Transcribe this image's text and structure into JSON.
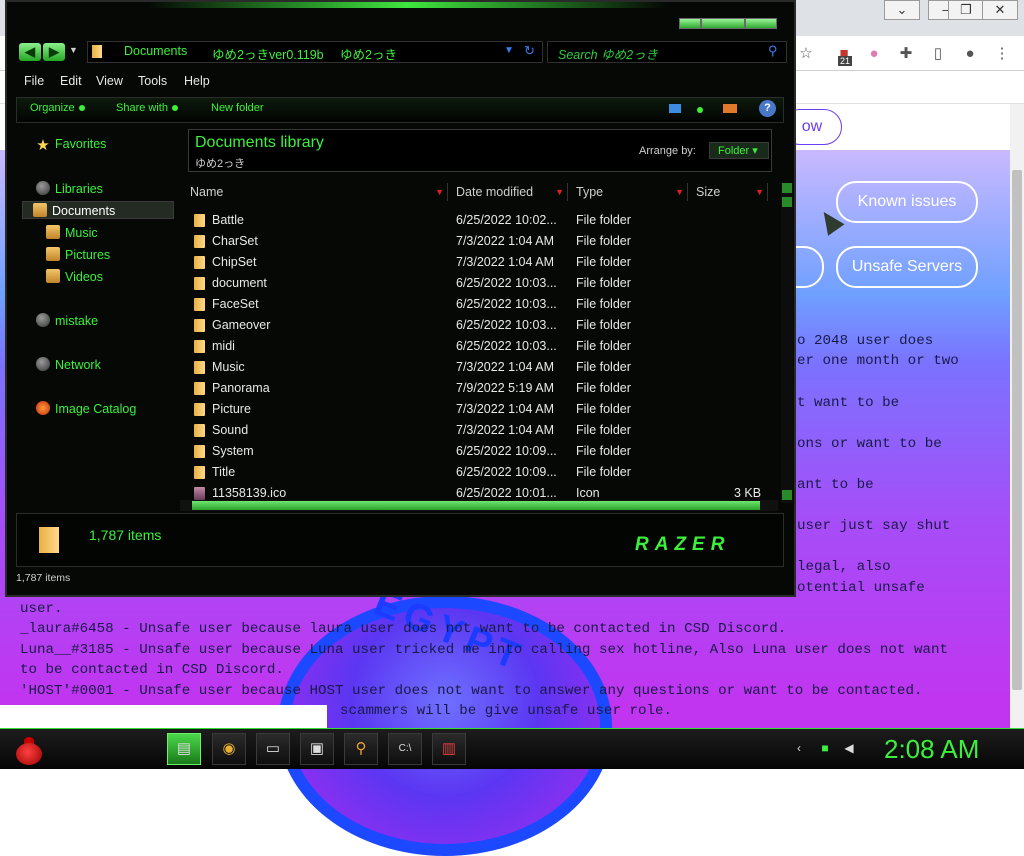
{
  "browser": {
    "pill_now": "ow",
    "known_issues": "Known issues",
    "unsafe_servers": "Unsafe Servers",
    "pill_cut": "s",
    "page_lines": [
      "o 2048 user does",
      "er one month or two",
      "t want to be",
      "ons or want to be",
      "ant to be",
      "user just say shut",
      " legal, also",
      "otential unsafe",
      "user.",
      "_laura#6458 - Unsafe user because laura user does not want to be contacted in CSD Discord.",
      "Luna__#3185 - Unsafe user because Luna user tricked me into calling sex hotline, Also Luna user does not want",
      "to be contacted in CSD Discord.",
      "'HOST'#0001 - Unsafe user because HOST user does not want to answer any questions or want to be contacted.",
      "scammers will be give unsafe user role."
    ],
    "emblem_text": "EGYPT",
    "badge_count": "21"
  },
  "explorer": {
    "breadcrumbs": [
      "Documents",
      "ゆめ2っきver0.119b",
      "ゆめ2っき"
    ],
    "search_placeholder": "Search ゆめ2っき",
    "menu": [
      "File",
      "Edit",
      "View",
      "Tools",
      "Help"
    ],
    "commands": {
      "organize": "Organize",
      "share_with": "Share with",
      "new_folder": "New folder"
    },
    "nav": {
      "favorites": "Favorites",
      "libraries": "Libraries",
      "documents": "Documents",
      "music": "Music",
      "pictures": "Pictures",
      "videos": "Videos",
      "mistake": "mistake",
      "network": "Network",
      "image_catalog": "Image Catalog"
    },
    "library": {
      "title": "Documents library",
      "subtitle": "ゆめ2っき",
      "arrange_label": "Arrange by:",
      "arrange_value": "Folder"
    },
    "columns": [
      "Name",
      "Date modified",
      "Type",
      "Size"
    ],
    "files": [
      {
        "name": "Battle",
        "date": "6/25/2022 10:02...",
        "type": "File folder",
        "size": ""
      },
      {
        "name": "CharSet",
        "date": "7/3/2022 1:04 AM",
        "type": "File folder",
        "size": ""
      },
      {
        "name": "ChipSet",
        "date": "7/3/2022 1:04 AM",
        "type": "File folder",
        "size": ""
      },
      {
        "name": "document",
        "date": "6/25/2022 10:03...",
        "type": "File folder",
        "size": ""
      },
      {
        "name": "FaceSet",
        "date": "6/25/2022 10:03...",
        "type": "File folder",
        "size": ""
      },
      {
        "name": "Gameover",
        "date": "6/25/2022 10:03...",
        "type": "File folder",
        "size": ""
      },
      {
        "name": "midi",
        "date": "6/25/2022 10:03...",
        "type": "File folder",
        "size": ""
      },
      {
        "name": "Music",
        "date": "7/3/2022 1:04 AM",
        "type": "File folder",
        "size": ""
      },
      {
        "name": "Panorama",
        "date": "7/9/2022 5:19 AM",
        "type": "File folder",
        "size": ""
      },
      {
        "name": "Picture",
        "date": "7/3/2022 1:04 AM",
        "type": "File folder",
        "size": ""
      },
      {
        "name": "Sound",
        "date": "7/3/2022 1:04 AM",
        "type": "File folder",
        "size": ""
      },
      {
        "name": "System",
        "date": "6/25/2022 10:09...",
        "type": "File folder",
        "size": ""
      },
      {
        "name": "Title",
        "date": "6/25/2022 10:09...",
        "type": "File folder",
        "size": ""
      },
      {
        "name": "11358139.ico",
        "date": "6/25/2022 10:01...",
        "type": "Icon",
        "size": "3 KB"
      }
    ],
    "details_count": "1,787 items",
    "status_text": "1,787 items",
    "logo_text": "RAZER"
  },
  "taskbar": {
    "clock": "2:08 AM"
  },
  "colors": {
    "accent_green": "#3cf03c",
    "page_violet": "#6a3cf5"
  }
}
